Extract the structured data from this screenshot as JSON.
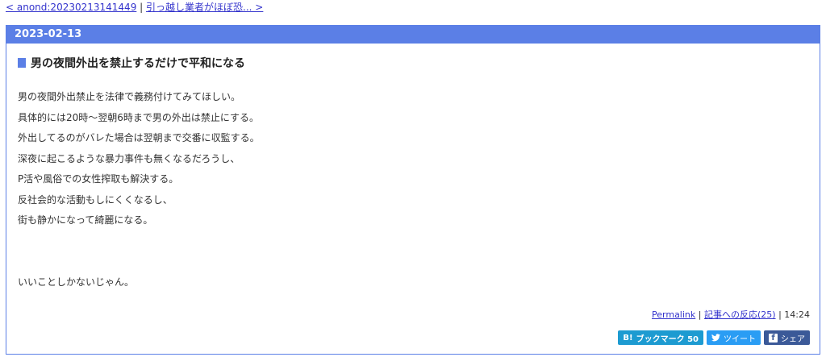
{
  "nav": {
    "prev_link": "< anond:20230213141449",
    "separator": "|",
    "next_link": "引っ越し業者がほぼ恐... >"
  },
  "day": {
    "date": "2023-02-13"
  },
  "entry": {
    "title": "男の夜間外出を禁止するだけで平和になる",
    "lines": [
      "男の夜間外出禁止を法律で義務付けてみてほしい。",
      "具体的には20時～翌朝6時まで男の外出は禁止にする。",
      "外出してるのがバレた場合は翌朝まで交番に収監する。",
      "深夜に起こるような暴力事件も無くなるだろうし、",
      "P活や風俗での女性搾取も解決する。",
      "反社会的な活動もしにくくなるし、",
      "街も静かになって綺麗になる。"
    ],
    "closing": "いいことしかないじゃん。"
  },
  "footer": {
    "permalink": "Permalink",
    "sep1": "|",
    "reactions": "記事への反応(25)",
    "sep2": "|",
    "time": "14:24"
  },
  "share": {
    "hatena_icon": "B!",
    "hatena_label": "ブックマーク 50",
    "tweet_label": "ツイート",
    "fb_icon": "f",
    "fb_label": "シェア"
  }
}
